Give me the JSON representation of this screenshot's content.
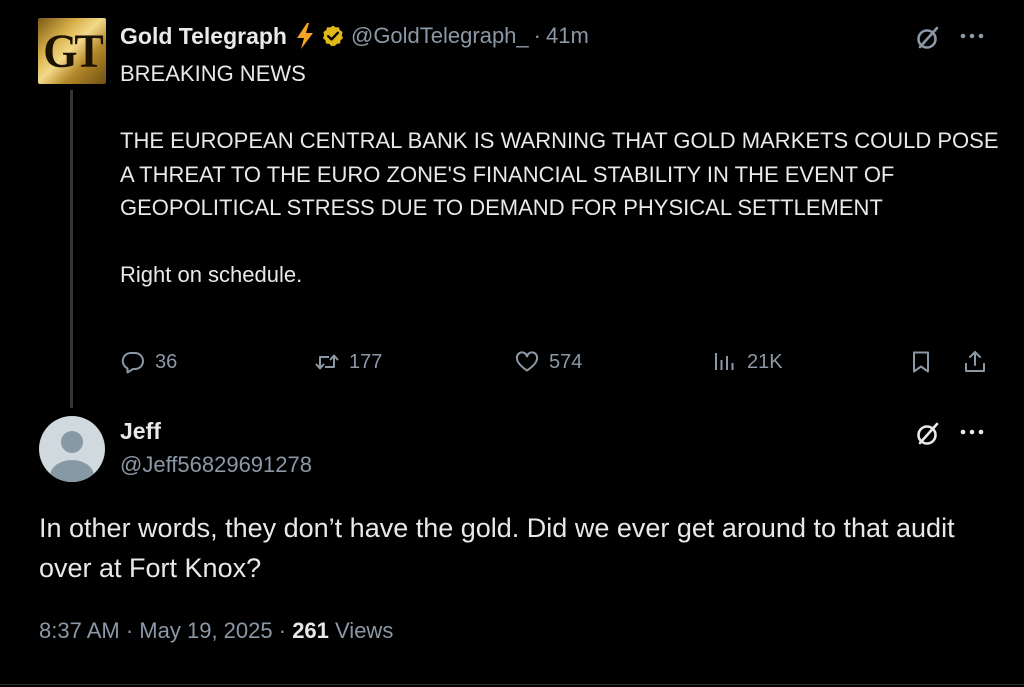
{
  "main_tweet": {
    "avatar_text": "GT",
    "display_name": "Gold Telegraph",
    "badge_icon": "lightning-icon",
    "verified_icon": "verified-badge-icon",
    "handle": "@GoldTelegraph_",
    "separator": "·",
    "time_ago": "41m",
    "text": {
      "line1": "BREAKING NEWS",
      "line2": "THE EUROPEAN CENTRAL BANK IS WARNING THAT GOLD MARKETS COULD POSE A THREAT TO THE EURO ZONE'S FINANCIAL STABILITY IN THE EVENT OF GEOPOLITICAL STRESS DUE TO DEMAND FOR PHYSICAL SETTLEMENT",
      "line3": "Right on schedule."
    },
    "actions": {
      "replies": "36",
      "reposts": "177",
      "likes": "574",
      "views": "21K"
    }
  },
  "reply_tweet": {
    "display_name": "Jeff",
    "handle": "@Jeff56829691278",
    "text": "In other words, they don’t have the gold.  Did we ever get around to that audit over at Fort Knox?",
    "time": "8:37 AM",
    "separator": "·",
    "date": "May 19, 2025",
    "views_count": "261",
    "views_label": "Views"
  },
  "colors": {
    "background": "#000000",
    "text_primary": "#e7e9ea",
    "text_secondary": "#8b98a5",
    "verified_gold": "#e2b719",
    "lightning": "#f7a325",
    "thread_line": "#333639"
  }
}
